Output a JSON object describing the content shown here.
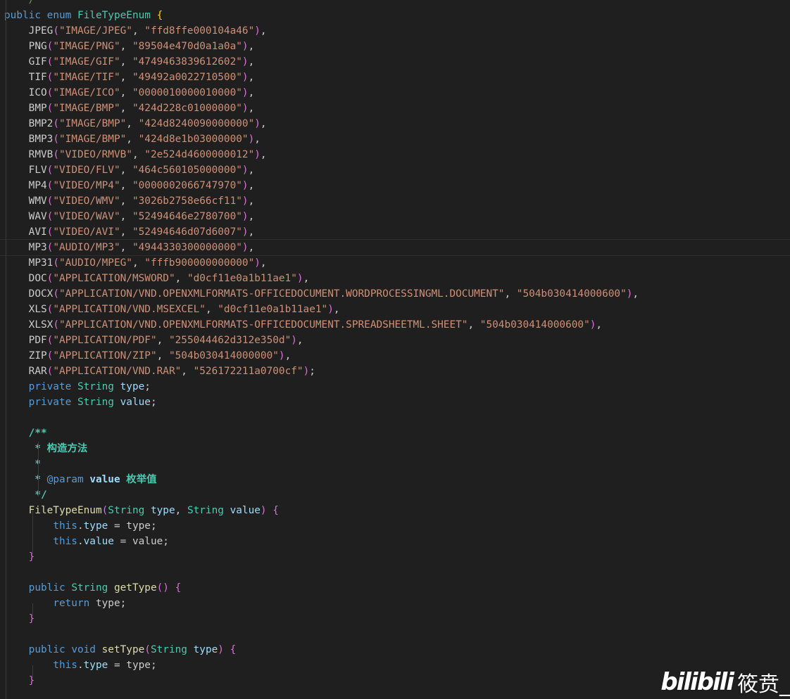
{
  "colors": {
    "background": "#1f1f1f",
    "default": "#cccccc",
    "keyword": "#569cd6",
    "type": "#4ec9b0",
    "string": "#ce9178",
    "function": "#dcdcaa",
    "variable": "#9cdcfe",
    "bracket_gold": "#ffd700",
    "bracket_pink": "#da70d6",
    "bracket_blue": "#179fff",
    "comment": "#6a9955",
    "doc_comment": "#4ec9b0",
    "doc_tag": "#569cd6"
  },
  "code": {
    "lines": [
      [
        [
          "t",
          "  **/",
          "comment"
        ]
      ],
      [
        [
          "k",
          "public ",
          "keyword"
        ],
        [
          "k",
          "enum ",
          "keyword"
        ],
        [
          "c",
          "FileTypeEnum ",
          "type"
        ],
        [
          "b",
          "{",
          "bracket_gold"
        ]
      ],
      [
        [
          "s",
          "    JPEG",
          "default"
        ],
        [
          "b",
          "(",
          "bracket_pink"
        ],
        [
          "x",
          "\"IMAGE/JPEG\"",
          "string"
        ],
        [
          "p",
          ", ",
          "default"
        ],
        [
          "x",
          "\"ffd8ffe000104a46\"",
          "string"
        ],
        [
          "b",
          ")",
          "bracket_pink"
        ],
        [
          "p",
          ",",
          "default"
        ]
      ],
      [
        [
          "s",
          "    PNG",
          "default"
        ],
        [
          "b",
          "(",
          "bracket_pink"
        ],
        [
          "x",
          "\"IMAGE/PNG\"",
          "string"
        ],
        [
          "p",
          ", ",
          "default"
        ],
        [
          "x",
          "\"89504e470d0a1a0a\"",
          "string"
        ],
        [
          "b",
          ")",
          "bracket_pink"
        ],
        [
          "p",
          ",",
          "default"
        ]
      ],
      [
        [
          "s",
          "    GIF",
          "default"
        ],
        [
          "b",
          "(",
          "bracket_pink"
        ],
        [
          "x",
          "\"IMAGE/GIF\"",
          "string"
        ],
        [
          "p",
          ", ",
          "default"
        ],
        [
          "x",
          "\"4749463839612602\"",
          "string"
        ],
        [
          "b",
          ")",
          "bracket_pink"
        ],
        [
          "p",
          ",",
          "default"
        ]
      ],
      [
        [
          "s",
          "    TIF",
          "default"
        ],
        [
          "b",
          "(",
          "bracket_pink"
        ],
        [
          "x",
          "\"IMAGE/TIF\"",
          "string"
        ],
        [
          "p",
          ", ",
          "default"
        ],
        [
          "x",
          "\"49492a0022710500\"",
          "string"
        ],
        [
          "b",
          ")",
          "bracket_pink"
        ],
        [
          "p",
          ",",
          "default"
        ]
      ],
      [
        [
          "s",
          "    ICO",
          "default"
        ],
        [
          "b",
          "(",
          "bracket_pink"
        ],
        [
          "x",
          "\"IMAGE/ICO\"",
          "string"
        ],
        [
          "p",
          ", ",
          "default"
        ],
        [
          "x",
          "\"0000010000010000\"",
          "string"
        ],
        [
          "b",
          ")",
          "bracket_pink"
        ],
        [
          "p",
          ",",
          "default"
        ]
      ],
      [
        [
          "s",
          "    BMP",
          "default"
        ],
        [
          "b",
          "(",
          "bracket_pink"
        ],
        [
          "x",
          "\"IMAGE/BMP\"",
          "string"
        ],
        [
          "p",
          ", ",
          "default"
        ],
        [
          "x",
          "\"424d228c01000000\"",
          "string"
        ],
        [
          "b",
          ")",
          "bracket_pink"
        ],
        [
          "p",
          ",",
          "default"
        ]
      ],
      [
        [
          "s",
          "    BMP2",
          "default"
        ],
        [
          "b",
          "(",
          "bracket_pink"
        ],
        [
          "x",
          "\"IMAGE/BMP\"",
          "string"
        ],
        [
          "p",
          ", ",
          "default"
        ],
        [
          "x",
          "\"424d8240090000000\"",
          "string"
        ],
        [
          "b",
          ")",
          "bracket_pink"
        ],
        [
          "p",
          ",",
          "default"
        ]
      ],
      [
        [
          "s",
          "    BMP3",
          "default"
        ],
        [
          "b",
          "(",
          "bracket_pink"
        ],
        [
          "x",
          "\"IMAGE/BMP\"",
          "string"
        ],
        [
          "p",
          ", ",
          "default"
        ],
        [
          "x",
          "\"424d8e1b03000000\"",
          "string"
        ],
        [
          "b",
          ")",
          "bracket_pink"
        ],
        [
          "p",
          ",",
          "default"
        ]
      ],
      [
        [
          "s",
          "    RMVB",
          "default"
        ],
        [
          "b",
          "(",
          "bracket_pink"
        ],
        [
          "x",
          "\"VIDEO/RMVB\"",
          "string"
        ],
        [
          "p",
          ", ",
          "default"
        ],
        [
          "x",
          "\"2e524d4600000012\"",
          "string"
        ],
        [
          "b",
          ")",
          "bracket_pink"
        ],
        [
          "p",
          ",",
          "default"
        ]
      ],
      [
        [
          "s",
          "    FLV",
          "default"
        ],
        [
          "b",
          "(",
          "bracket_pink"
        ],
        [
          "x",
          "\"VIDEO/FLV\"",
          "string"
        ],
        [
          "p",
          ", ",
          "default"
        ],
        [
          "x",
          "\"464c560105000000\"",
          "string"
        ],
        [
          "b",
          ")",
          "bracket_pink"
        ],
        [
          "p",
          ",",
          "default"
        ]
      ],
      [
        [
          "s",
          "    MP4",
          "default"
        ],
        [
          "b",
          "(",
          "bracket_pink"
        ],
        [
          "x",
          "\"VIDEO/MP4\"",
          "string"
        ],
        [
          "p",
          ", ",
          "default"
        ],
        [
          "x",
          "\"0000002066747970\"",
          "string"
        ],
        [
          "b",
          ")",
          "bracket_pink"
        ],
        [
          "p",
          ",",
          "default"
        ]
      ],
      [
        [
          "s",
          "    WMV",
          "default"
        ],
        [
          "b",
          "(",
          "bracket_pink"
        ],
        [
          "x",
          "\"VIDEO/WMV\"",
          "string"
        ],
        [
          "p",
          ", ",
          "default"
        ],
        [
          "x",
          "\"3026b2758e66cf11\"",
          "string"
        ],
        [
          "b",
          ")",
          "bracket_pink"
        ],
        [
          "p",
          ",",
          "default"
        ]
      ],
      [
        [
          "s",
          "    WAV",
          "default"
        ],
        [
          "b",
          "(",
          "bracket_pink"
        ],
        [
          "x",
          "\"VIDEO/WAV\"",
          "string"
        ],
        [
          "p",
          ", ",
          "default"
        ],
        [
          "x",
          "\"52494646e2780700\"",
          "string"
        ],
        [
          "b",
          ")",
          "bracket_pink"
        ],
        [
          "p",
          ",",
          "default"
        ]
      ],
      [
        [
          "s",
          "    AVI",
          "default"
        ],
        [
          "b",
          "(",
          "bracket_pink"
        ],
        [
          "x",
          "\"VIDEO/AVI\"",
          "string"
        ],
        [
          "p",
          ", ",
          "default"
        ],
        [
          "x",
          "\"52494646d07d6007\"",
          "string"
        ],
        [
          "b",
          ")",
          "bracket_pink"
        ],
        [
          "p",
          ",",
          "default"
        ]
      ],
      [
        [
          "s",
          "    MP3",
          "default"
        ],
        [
          "b",
          "(",
          "bracket_pink"
        ],
        [
          "x",
          "\"AUDIO/MP3\"",
          "string"
        ],
        [
          "p",
          ", ",
          "default"
        ],
        [
          "x",
          "\"4944330300000000\"",
          "string"
        ],
        [
          "b",
          ")",
          "bracket_pink"
        ],
        [
          "p",
          ",",
          "default"
        ]
      ],
      [
        [
          "s",
          "    MP31",
          "default"
        ],
        [
          "b",
          "(",
          "bracket_pink"
        ],
        [
          "x",
          "\"AUDIO/MPEG\"",
          "string"
        ],
        [
          "p",
          ", ",
          "default"
        ],
        [
          "x",
          "\"fffb900000000000\"",
          "string"
        ],
        [
          "b",
          ")",
          "bracket_pink"
        ],
        [
          "p",
          ",",
          "default"
        ]
      ],
      [
        [
          "s",
          "    DOC",
          "default"
        ],
        [
          "b",
          "(",
          "bracket_pink"
        ],
        [
          "x",
          "\"APPLICATION/MSWORD\"",
          "string"
        ],
        [
          "p",
          ", ",
          "default"
        ],
        [
          "x",
          "\"d0cf11e0a1b11ae1\"",
          "string"
        ],
        [
          "b",
          ")",
          "bracket_pink"
        ],
        [
          "p",
          ",",
          "default"
        ]
      ],
      [
        [
          "s",
          "    DOCX",
          "default"
        ],
        [
          "b",
          "(",
          "bracket_pink"
        ],
        [
          "x",
          "\"APPLICATION/VND.OPENXMLFORMATS-OFFICEDOCUMENT.WORDPROCESSINGML.DOCUMENT\"",
          "string"
        ],
        [
          "p",
          ", ",
          "default"
        ],
        [
          "x",
          "\"504b030414000600\"",
          "string"
        ],
        [
          "b",
          ")",
          "bracket_pink"
        ],
        [
          "p",
          ",",
          "default"
        ]
      ],
      [
        [
          "s",
          "    XLS",
          "default"
        ],
        [
          "b",
          "(",
          "bracket_pink"
        ],
        [
          "x",
          "\"APPLICATION/VND.MSEXCEL\"",
          "string"
        ],
        [
          "p",
          ", ",
          "default"
        ],
        [
          "x",
          "\"d0cf11e0a1b11ae1\"",
          "string"
        ],
        [
          "b",
          ")",
          "bracket_pink"
        ],
        [
          "p",
          ",",
          "default"
        ]
      ],
      [
        [
          "s",
          "    XLSX",
          "default"
        ],
        [
          "b",
          "(",
          "bracket_pink"
        ],
        [
          "x",
          "\"APPLICATION/VND.OPENXMLFORMATS-OFFICEDOCUMENT.SPREADSHEETML.SHEET\"",
          "string"
        ],
        [
          "p",
          ", ",
          "default"
        ],
        [
          "x",
          "\"504b030414000600\"",
          "string"
        ],
        [
          "b",
          ")",
          "bracket_pink"
        ],
        [
          "p",
          ",",
          "default"
        ]
      ],
      [
        [
          "s",
          "    PDF",
          "default"
        ],
        [
          "b",
          "(",
          "bracket_pink"
        ],
        [
          "x",
          "\"APPLICATION/PDF\"",
          "string"
        ],
        [
          "p",
          ", ",
          "default"
        ],
        [
          "x",
          "\"255044462d312e350d\"",
          "string"
        ],
        [
          "b",
          ")",
          "bracket_pink"
        ],
        [
          "p",
          ",",
          "default"
        ]
      ],
      [
        [
          "s",
          "    ZIP",
          "default"
        ],
        [
          "b",
          "(",
          "bracket_pink"
        ],
        [
          "x",
          "\"APPLICATION/ZIP\"",
          "string"
        ],
        [
          "p",
          ", ",
          "default"
        ],
        [
          "x",
          "\"504b030414000000\"",
          "string"
        ],
        [
          "b",
          ")",
          "bracket_pink"
        ],
        [
          "p",
          ",",
          "default"
        ]
      ],
      [
        [
          "s",
          "    RAR",
          "default"
        ],
        [
          "b",
          "(",
          "bracket_pink"
        ],
        [
          "x",
          "\"APPLICATION/VND.RAR\"",
          "string"
        ],
        [
          "p",
          ", ",
          "default"
        ],
        [
          "x",
          "\"526172211a0700cf\"",
          "string"
        ],
        [
          "b",
          ")",
          "bracket_pink"
        ],
        [
          "p",
          ";",
          "default"
        ]
      ],
      [
        [
          "s",
          "    ",
          "default"
        ],
        [
          "k",
          "private ",
          "keyword"
        ],
        [
          "c",
          "String ",
          "type"
        ],
        [
          "v",
          "type",
          "variable"
        ],
        [
          "p",
          ";",
          "default"
        ]
      ],
      [
        [
          "s",
          "    ",
          "default"
        ],
        [
          "k",
          "private ",
          "keyword"
        ],
        [
          "c",
          "String ",
          "type"
        ],
        [
          "v",
          "value",
          "variable"
        ],
        [
          "p",
          ";",
          "default"
        ]
      ],
      [],
      [
        [
          "s",
          "    ",
          "default"
        ],
        [
          "d",
          "/**",
          "doc_comment"
        ]
      ],
      [
        [
          "s",
          "     ",
          "default"
        ],
        [
          "d",
          "* ",
          "doc_comment"
        ],
        [
          "j",
          "构造方法",
          "doc_comment"
        ]
      ],
      [
        [
          "s",
          "     ",
          "default"
        ],
        [
          "d",
          "*",
          "doc_comment"
        ]
      ],
      [
        [
          "s",
          "     ",
          "default"
        ],
        [
          "d",
          "* ",
          "doc_comment"
        ],
        [
          "g",
          "@param ",
          "doc_tag"
        ],
        [
          "w",
          "value ",
          "variable"
        ],
        [
          "j",
          "枚举值",
          "doc_comment"
        ]
      ],
      [
        [
          "s",
          "     ",
          "default"
        ],
        [
          "d",
          "*/",
          "doc_comment"
        ]
      ],
      [
        [
          "f",
          "    FileTypeEnum",
          "function"
        ],
        [
          "b",
          "(",
          "bracket_pink"
        ],
        [
          "c",
          "String ",
          "type"
        ],
        [
          "v",
          "type",
          "variable"
        ],
        [
          "p",
          ", ",
          "default"
        ],
        [
          "c",
          "String ",
          "type"
        ],
        [
          "v",
          "value",
          "variable"
        ],
        [
          "b",
          ")",
          "bracket_pink"
        ],
        [
          "p",
          " ",
          "default"
        ],
        [
          "b",
          "{",
          "bracket_pink"
        ]
      ],
      [
        [
          "s",
          "        ",
          "default"
        ],
        [
          "k",
          "this",
          "keyword"
        ],
        [
          "p",
          ".",
          "default"
        ],
        [
          "v",
          "type",
          "variable"
        ],
        [
          "p",
          " = type;",
          "default"
        ]
      ],
      [
        [
          "s",
          "        ",
          "default"
        ],
        [
          "k",
          "this",
          "keyword"
        ],
        [
          "p",
          ".",
          "default"
        ],
        [
          "v",
          "value",
          "variable"
        ],
        [
          "p",
          " = value;",
          "default"
        ]
      ],
      [
        [
          "s",
          "    ",
          "default"
        ],
        [
          "b",
          "}",
          "bracket_pink"
        ]
      ],
      [],
      [
        [
          "s",
          "    ",
          "default"
        ],
        [
          "k",
          "public ",
          "keyword"
        ],
        [
          "c",
          "String ",
          "type"
        ],
        [
          "f",
          "getType",
          "function"
        ],
        [
          "b",
          "()",
          "bracket_pink"
        ],
        [
          "p",
          " ",
          "default"
        ],
        [
          "b",
          "{",
          "bracket_pink"
        ]
      ],
      [
        [
          "s",
          "        ",
          "default"
        ],
        [
          "k",
          "return ",
          "keyword"
        ],
        [
          "p",
          "type;",
          "default"
        ]
      ],
      [
        [
          "s",
          "    ",
          "default"
        ],
        [
          "b",
          "}",
          "bracket_pink"
        ]
      ],
      [],
      [
        [
          "s",
          "    ",
          "default"
        ],
        [
          "k",
          "public ",
          "keyword"
        ],
        [
          "k",
          "void ",
          "keyword"
        ],
        [
          "f",
          "setType",
          "function"
        ],
        [
          "b",
          "(",
          "bracket_pink"
        ],
        [
          "c",
          "String ",
          "type"
        ],
        [
          "v",
          "type",
          "variable"
        ],
        [
          "b",
          ")",
          "bracket_pink"
        ],
        [
          "p",
          " ",
          "default"
        ],
        [
          "b",
          "{",
          "bracket_pink"
        ]
      ],
      [
        [
          "s",
          "        ",
          "default"
        ],
        [
          "k",
          "this",
          "keyword"
        ],
        [
          "p",
          ".",
          "default"
        ],
        [
          "v",
          "type",
          "variable"
        ],
        [
          "p",
          " = type;",
          "default"
        ]
      ],
      [
        [
          "s",
          "    ",
          "default"
        ],
        [
          "b",
          "}",
          "bracket_pink"
        ]
      ]
    ]
  },
  "watermark": {
    "logo": "bilibili",
    "author": "筱贲_"
  }
}
